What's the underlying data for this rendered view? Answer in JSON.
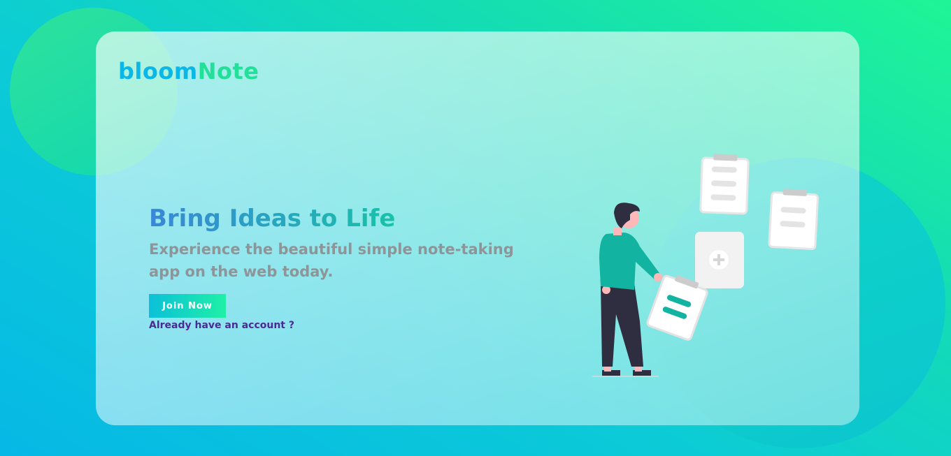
{
  "brand": {
    "name_part1": "bloom",
    "name_part2": "Note"
  },
  "hero": {
    "title": "Bring Ideas to Life",
    "subtitle": "Experience the beautiful simple note-taking app on the web today.",
    "join_button_label": "Join Now",
    "login_link_label": "Already have an account ?"
  },
  "colors": {
    "brand_blue": "#0ab7e6",
    "brand_green": "#22df9a",
    "link_purple": "#4b2a96",
    "subtitle_gray": "#8e9598",
    "illustration_teal": "#12b3a0"
  },
  "illustration": {
    "icons": [
      "person-icon",
      "clipboard-icon",
      "add-note-icon"
    ]
  }
}
